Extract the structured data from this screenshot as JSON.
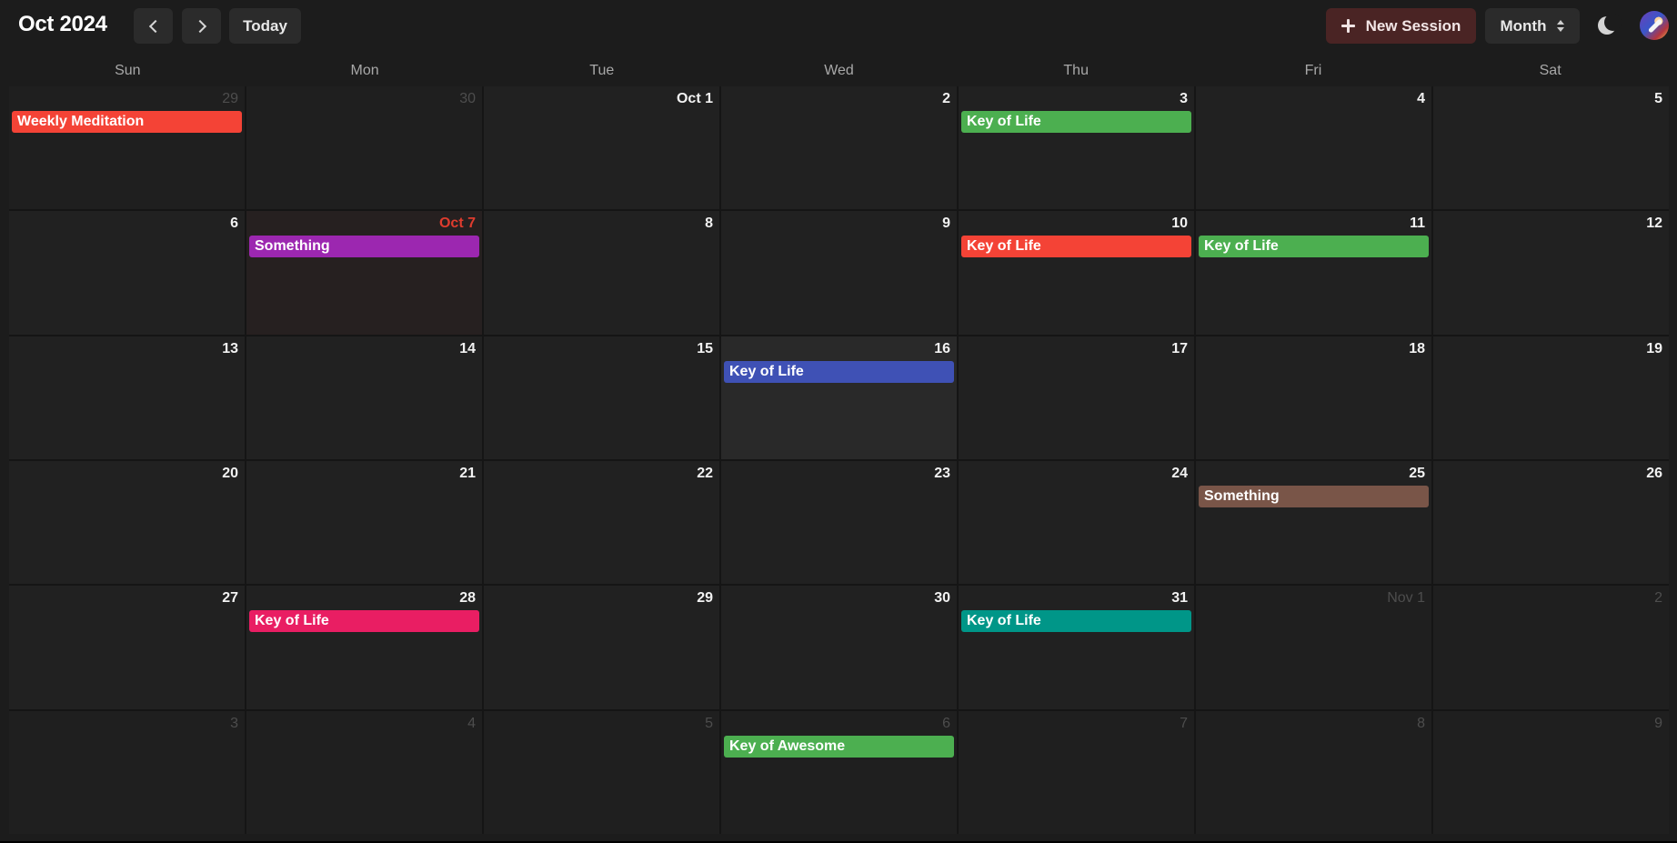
{
  "header": {
    "title": "Oct 2024",
    "today_label": "Today",
    "new_session_label": "New Session",
    "view_label": "Month"
  },
  "icons": {
    "prev": "chevron-left-icon",
    "next": "chevron-right-icon",
    "new": "plus-icon",
    "view": "updown-chevron-icon",
    "theme": "moon-icon",
    "avatar": "avatar"
  },
  "weekdays": [
    "Sun",
    "Mon",
    "Tue",
    "Wed",
    "Thu",
    "Fri",
    "Sat"
  ],
  "colors": {
    "red": "#f44336",
    "green": "#4caf50",
    "purple": "#9c27b0",
    "indigo": "#3f51b5",
    "brown": "#795548",
    "pink": "#e91e63",
    "teal": "#009688",
    "today": "#e03c2e"
  },
  "weeks": [
    [
      {
        "label": "29",
        "out": true,
        "events": [
          {
            "title": "Weekly Meditation",
            "color": "#f44336"
          }
        ]
      },
      {
        "label": "30",
        "out": true,
        "events": []
      },
      {
        "label": "Oct 1",
        "events": []
      },
      {
        "label": "2",
        "events": []
      },
      {
        "label": "3",
        "events": [
          {
            "title": "Key of Life",
            "color": "#4caf50"
          }
        ]
      },
      {
        "label": "4",
        "events": []
      },
      {
        "label": "5",
        "events": []
      }
    ],
    [
      {
        "label": "6",
        "events": []
      },
      {
        "label": "Oct 7",
        "today": true,
        "selected": true,
        "events": [
          {
            "title": "Something",
            "color": "#9c27b0"
          }
        ]
      },
      {
        "label": "8",
        "events": []
      },
      {
        "label": "9",
        "events": []
      },
      {
        "label": "10",
        "events": [
          {
            "title": "Key of Life",
            "color": "#f44336"
          }
        ]
      },
      {
        "label": "11",
        "events": [
          {
            "title": "Key of Life",
            "color": "#4caf50"
          }
        ]
      },
      {
        "label": "12",
        "events": []
      }
    ],
    [
      {
        "label": "13",
        "events": []
      },
      {
        "label": "14",
        "events": []
      },
      {
        "label": "15",
        "events": []
      },
      {
        "label": "16",
        "hovered": true,
        "events": [
          {
            "title": "Key of Life",
            "color": "#3f51b5"
          }
        ]
      },
      {
        "label": "17",
        "events": []
      },
      {
        "label": "18",
        "events": []
      },
      {
        "label": "19",
        "events": []
      }
    ],
    [
      {
        "label": "20",
        "events": []
      },
      {
        "label": "21",
        "events": []
      },
      {
        "label": "22",
        "events": []
      },
      {
        "label": "23",
        "events": []
      },
      {
        "label": "24",
        "events": []
      },
      {
        "label": "25",
        "events": [
          {
            "title": "Something",
            "color": "#795548"
          }
        ]
      },
      {
        "label": "26",
        "events": []
      }
    ],
    [
      {
        "label": "27",
        "events": []
      },
      {
        "label": "28",
        "events": [
          {
            "title": "Key of Life",
            "color": "#e91e63"
          }
        ]
      },
      {
        "label": "29",
        "events": []
      },
      {
        "label": "30",
        "events": []
      },
      {
        "label": "31",
        "events": [
          {
            "title": "Key of Life",
            "color": "#009688"
          }
        ]
      },
      {
        "label": "Nov 1",
        "out": true,
        "events": []
      },
      {
        "label": "2",
        "out": true,
        "events": []
      }
    ],
    [
      {
        "label": "3",
        "out": true,
        "events": []
      },
      {
        "label": "4",
        "out": true,
        "events": []
      },
      {
        "label": "5",
        "out": true,
        "events": []
      },
      {
        "label": "6",
        "out": true,
        "events": [
          {
            "title": "Key of Awesome",
            "color": "#4caf50"
          }
        ]
      },
      {
        "label": "7",
        "out": true,
        "events": []
      },
      {
        "label": "8",
        "out": true,
        "events": []
      },
      {
        "label": "9",
        "out": true,
        "events": []
      }
    ]
  ]
}
